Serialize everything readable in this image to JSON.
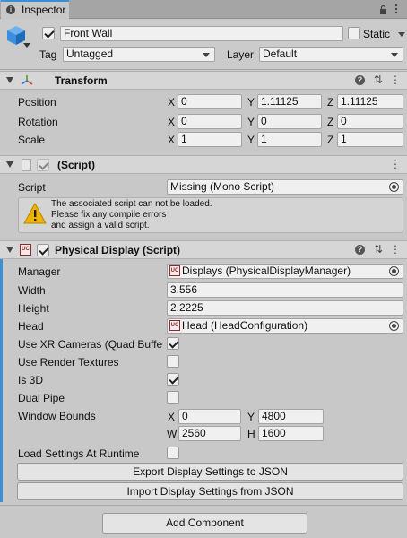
{
  "tab": {
    "label": "Inspector",
    "icon": "info-icon"
  },
  "tab_actions": {
    "lock": "lock-icon",
    "menu": "more-vertical-icon"
  },
  "header": {
    "name": "Front Wall",
    "active": true,
    "static_label": "Static",
    "static": false,
    "tag_label": "Tag",
    "tag": "Untagged",
    "layer_label": "Layer",
    "layer": "Default"
  },
  "transform": {
    "title": "Transform",
    "position": {
      "label": "Position",
      "x": "0",
      "y": "1.11125",
      "z": "1.11125"
    },
    "rotation": {
      "label": "Rotation",
      "x": "0",
      "y": "0",
      "z": "0"
    },
    "scale": {
      "label": "Scale",
      "x": "1",
      "y": "1",
      "z": "1"
    }
  },
  "axis": {
    "x": "X",
    "y": "Y",
    "z": "Z",
    "w": "W",
    "h": "H"
  },
  "missing_script": {
    "title": "(Script)",
    "script_label": "Script",
    "script_value": "Missing (Mono Script)",
    "warning": [
      "The associated script can not be loaded.",
      "Please fix any compile errors",
      "and assign a valid script."
    ]
  },
  "physical_display": {
    "title": "Physical Display (Script)",
    "manager_label": "Manager",
    "manager_value": "Displays (PhysicalDisplayManager)",
    "width_label": "Width",
    "width_value": "3.556",
    "height_label": "Height",
    "height_value": "2.2225",
    "head_label": "Head",
    "head_value": "Head (HeadConfiguration)",
    "use_xr_label": "Use XR Cameras (Quad Buffe",
    "use_xr": true,
    "use_rt_label": "Use Render Textures",
    "use_rt": false,
    "is3d_label": "Is 3D",
    "is3d": true,
    "dual_pipe_label": "Dual Pipe",
    "dual_pipe": false,
    "window_bounds_label": "Window Bounds",
    "wb_x": "0",
    "wb_y": "4800",
    "wb_w": "2560",
    "wb_h": "1600",
    "load_settings_label": "Load Settings At Runtime",
    "load_settings": false,
    "export_label": "Export Display Settings to JSON",
    "import_label": "Import Display Settings from JSON",
    "script_icon_text": "UC"
  },
  "add_component_label": "Add Component",
  "colors": {
    "accent_bar": "#3a8fd6",
    "warning": "#f0b400"
  }
}
